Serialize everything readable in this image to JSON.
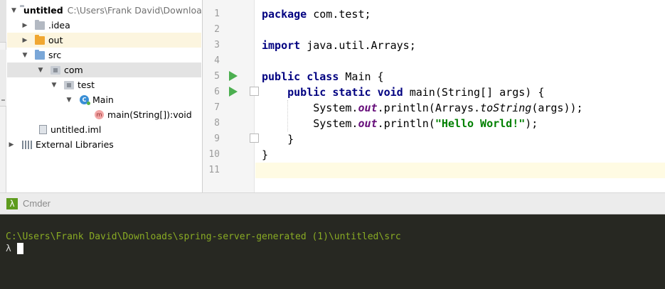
{
  "project_tree": {
    "root_label": "untitled",
    "root_path": "C:\\Users\\Frank David\\Downloads",
    "items": [
      {
        "label": ".idea"
      },
      {
        "label": "out"
      },
      {
        "label": "src"
      },
      {
        "label": "com"
      },
      {
        "label": "test"
      },
      {
        "label": "Main",
        "icon_letter": "C"
      },
      {
        "label": "main(String[]):void",
        "icon_letter": "m"
      },
      {
        "label": "untitled.iml"
      },
      {
        "label": "External Libraries"
      }
    ]
  },
  "editor": {
    "line_numbers": [
      "1",
      "2",
      "3",
      "4",
      "5",
      "6",
      "7",
      "8",
      "9",
      "10",
      "11"
    ],
    "code": {
      "l1_kw": "package",
      "l1_rest": " com.test;",
      "l3_kw": "import",
      "l3_rest": " java.util.Arrays;",
      "l5_kw1": "public",
      "l5_kw2": "class",
      "l5_rest": " Main {",
      "l6_indent": "    ",
      "l6_kw1": "public",
      "l6_kw2": "static",
      "l6_kw3": "void",
      "l6_rest": " main(String[] args) {",
      "l7_a": "        System.",
      "l7_field": "out",
      "l7_b": ".println(Arrays.",
      "l7_static": "toString",
      "l7_c": "(args));",
      "l8_a": "        System.",
      "l8_field": "out",
      "l8_b": ".println(",
      "l8_str": "\"Hello World!\"",
      "l8_c": ");",
      "l9": "    }",
      "l10": "}"
    }
  },
  "cmder": {
    "tab_title": "Cmder",
    "tab_icon_glyph": "λ",
    "path_line": "C:\\Users\\Frank David\\Downloads\\spring-server-generated (1)\\untitled\\src",
    "prompt": "λ"
  },
  "colors": {
    "keyword": "#000080",
    "string": "#008000",
    "field": "#660e7a",
    "terminal_bg": "#272822",
    "terminal_path": "#89ab24",
    "run_icon": "#4caf50"
  }
}
